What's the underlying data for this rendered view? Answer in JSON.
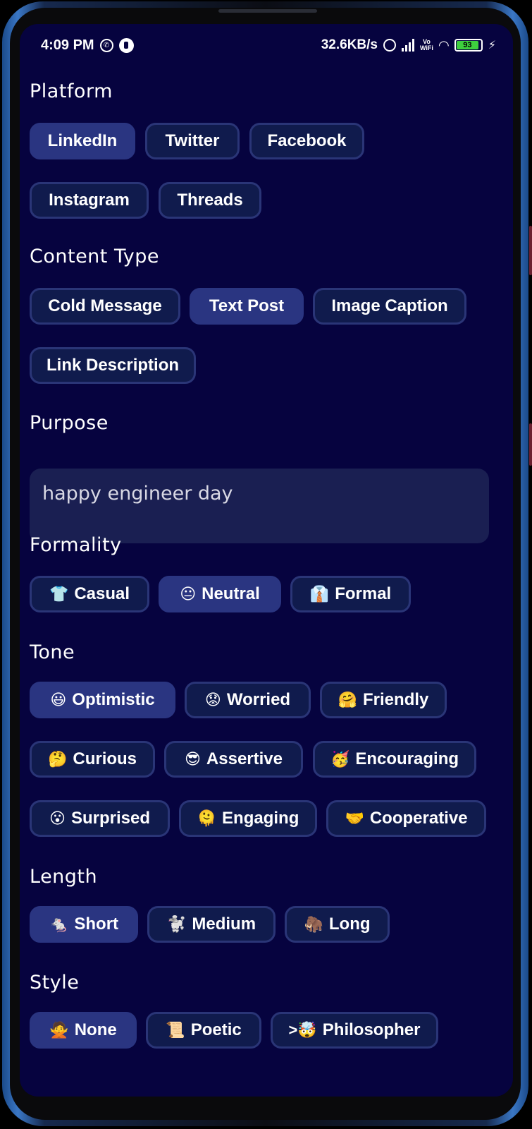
{
  "status_bar": {
    "time": "4:09 PM",
    "network_speed": "32.6KB/s",
    "vowifi_top": "Vo",
    "vowifi_bottom": "WiFi",
    "battery": "93"
  },
  "sections": {
    "platform": {
      "title": "Platform",
      "options": [
        "LinkedIn",
        "Twitter",
        "Facebook",
        "Instagram",
        "Threads"
      ],
      "selected": "LinkedIn"
    },
    "content_type": {
      "title": "Content Type",
      "options": [
        "Cold Message",
        "Text Post",
        "Image Caption",
        "Link Description"
      ],
      "selected": "Text Post"
    },
    "purpose": {
      "title": "Purpose",
      "value": "happy engineer day"
    },
    "formality": {
      "title": "Formality",
      "options": [
        {
          "emoji": "👕",
          "label": "Casual"
        },
        {
          "emoji": "😐",
          "label": "Neutral"
        },
        {
          "emoji": "👔",
          "label": "Formal"
        }
      ],
      "selected": "Neutral"
    },
    "tone": {
      "title": "Tone",
      "options": [
        {
          "emoji": "😃",
          "label": "Optimistic"
        },
        {
          "emoji": "😟",
          "label": "Worried"
        },
        {
          "emoji": "🤗",
          "label": "Friendly"
        },
        {
          "emoji": "🤔",
          "label": "Curious"
        },
        {
          "emoji": "😎",
          "label": "Assertive"
        },
        {
          "emoji": "🥳",
          "label": "Encouraging"
        },
        {
          "emoji": "😮",
          "label": "Surprised"
        },
        {
          "emoji": "🫠",
          "label": "Engaging"
        },
        {
          "emoji": "🤝",
          "label": "Cooperative"
        }
      ],
      "selected": "Optimistic"
    },
    "length": {
      "title": "Length",
      "options": [
        {
          "emoji": "🐁",
          "label": "Short"
        },
        {
          "emoji": "🐩",
          "label": "Medium"
        },
        {
          "emoji": "🦣",
          "label": "Long"
        }
      ],
      "selected": "Short"
    },
    "style": {
      "title": "Style",
      "options": [
        {
          "emoji": "🙅",
          "label": "None"
        },
        {
          "emoji": "📜",
          "label": "Poetic"
        },
        {
          "emoji": ">🤯",
          "label": "Philosopher"
        }
      ],
      "selected": "None"
    }
  },
  "colors": {
    "background": "#06033f",
    "chip": "#101b4d",
    "chip_border": "#2a3577",
    "chip_selected": "#2a3581",
    "input_bg": "#1a1f52"
  }
}
